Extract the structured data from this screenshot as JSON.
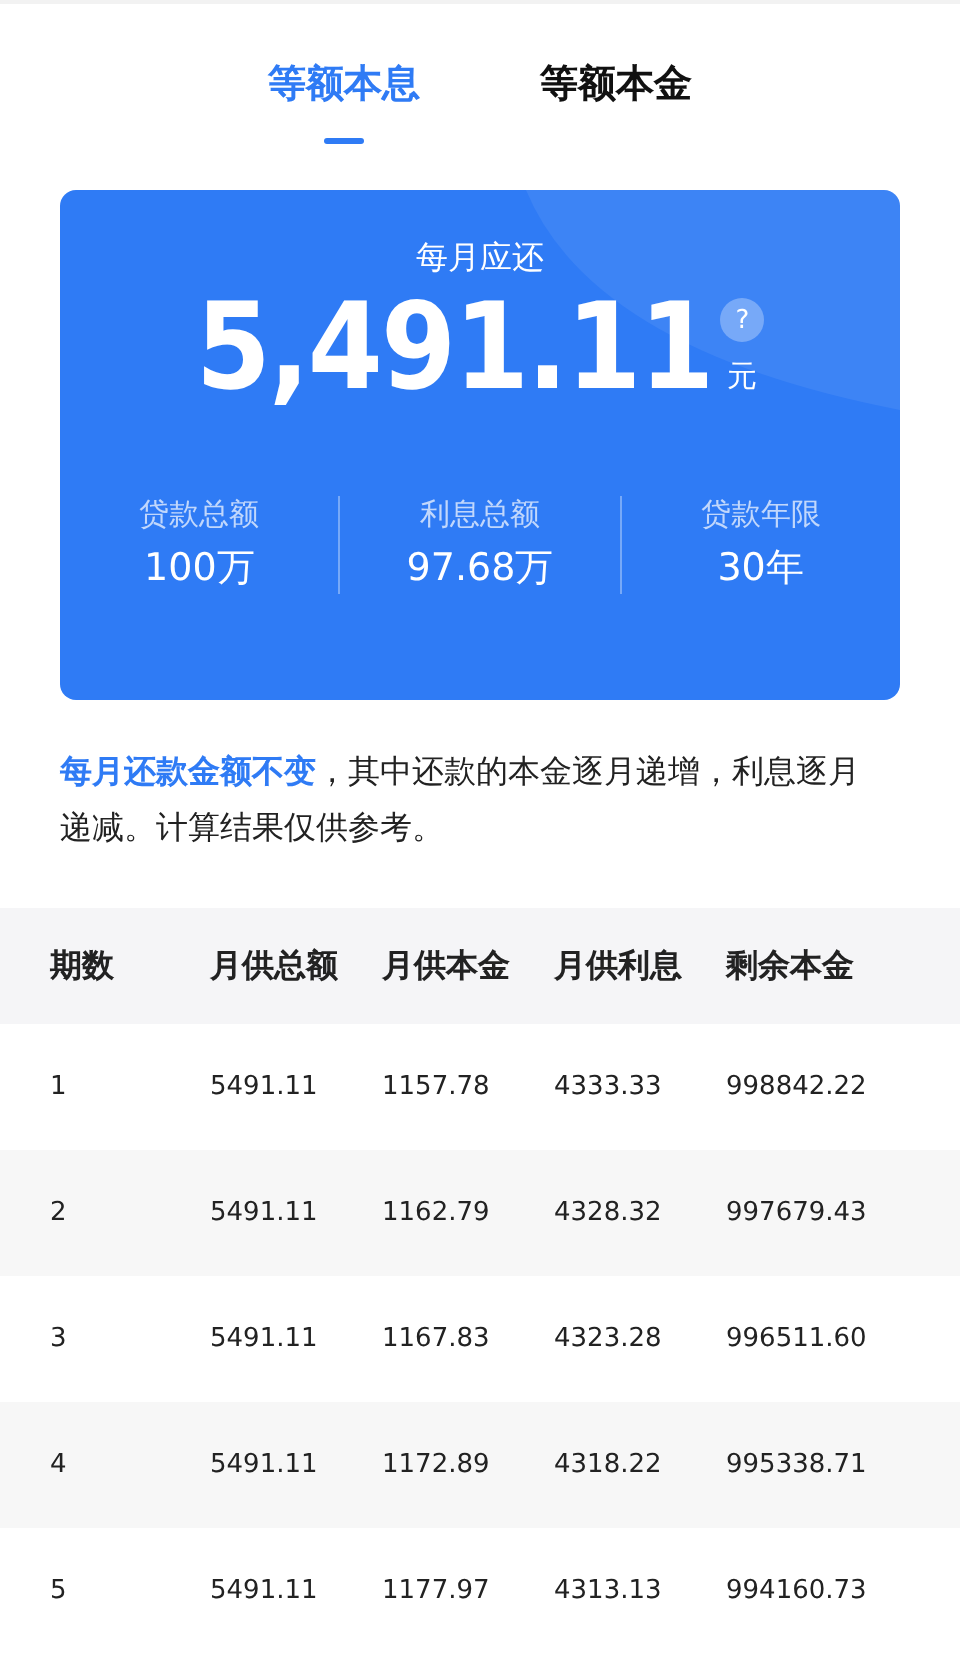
{
  "tabs": [
    {
      "label": "等额本息",
      "selected": true
    },
    {
      "label": "等额本金",
      "selected": false
    }
  ],
  "summary": {
    "title": "每月应还",
    "amount": "5,491.11",
    "help": "?",
    "unit": "元",
    "stats": [
      {
        "label": "贷款总额",
        "value": "100万"
      },
      {
        "label": "利息总额",
        "value": "97.68万"
      },
      {
        "label": "贷款年限",
        "value": "30年"
      }
    ]
  },
  "description": "**每月还款金额不变**，其中还款的本金逐月递增，利息逐月递减。计算结果仅供参考。",
  "table": {
    "columns": [
      "期数",
      "月供总额",
      "月供本金",
      "月供利息",
      "剩余本金"
    ],
    "rows": [
      [
        "1",
        "5491.11",
        "1157.78",
        "4333.33",
        "998842.22"
      ],
      [
        "2",
        "5491.11",
        "1162.79",
        "4328.32",
        "997679.43"
      ],
      [
        "3",
        "5491.11",
        "1167.83",
        "4323.28",
        "996511.60"
      ],
      [
        "4",
        "5491.11",
        "1172.89",
        "4318.22",
        "995338.71"
      ],
      [
        "5",
        "5491.11",
        "1177.97",
        "4313.13",
        "994160.73"
      ]
    ]
  }
}
